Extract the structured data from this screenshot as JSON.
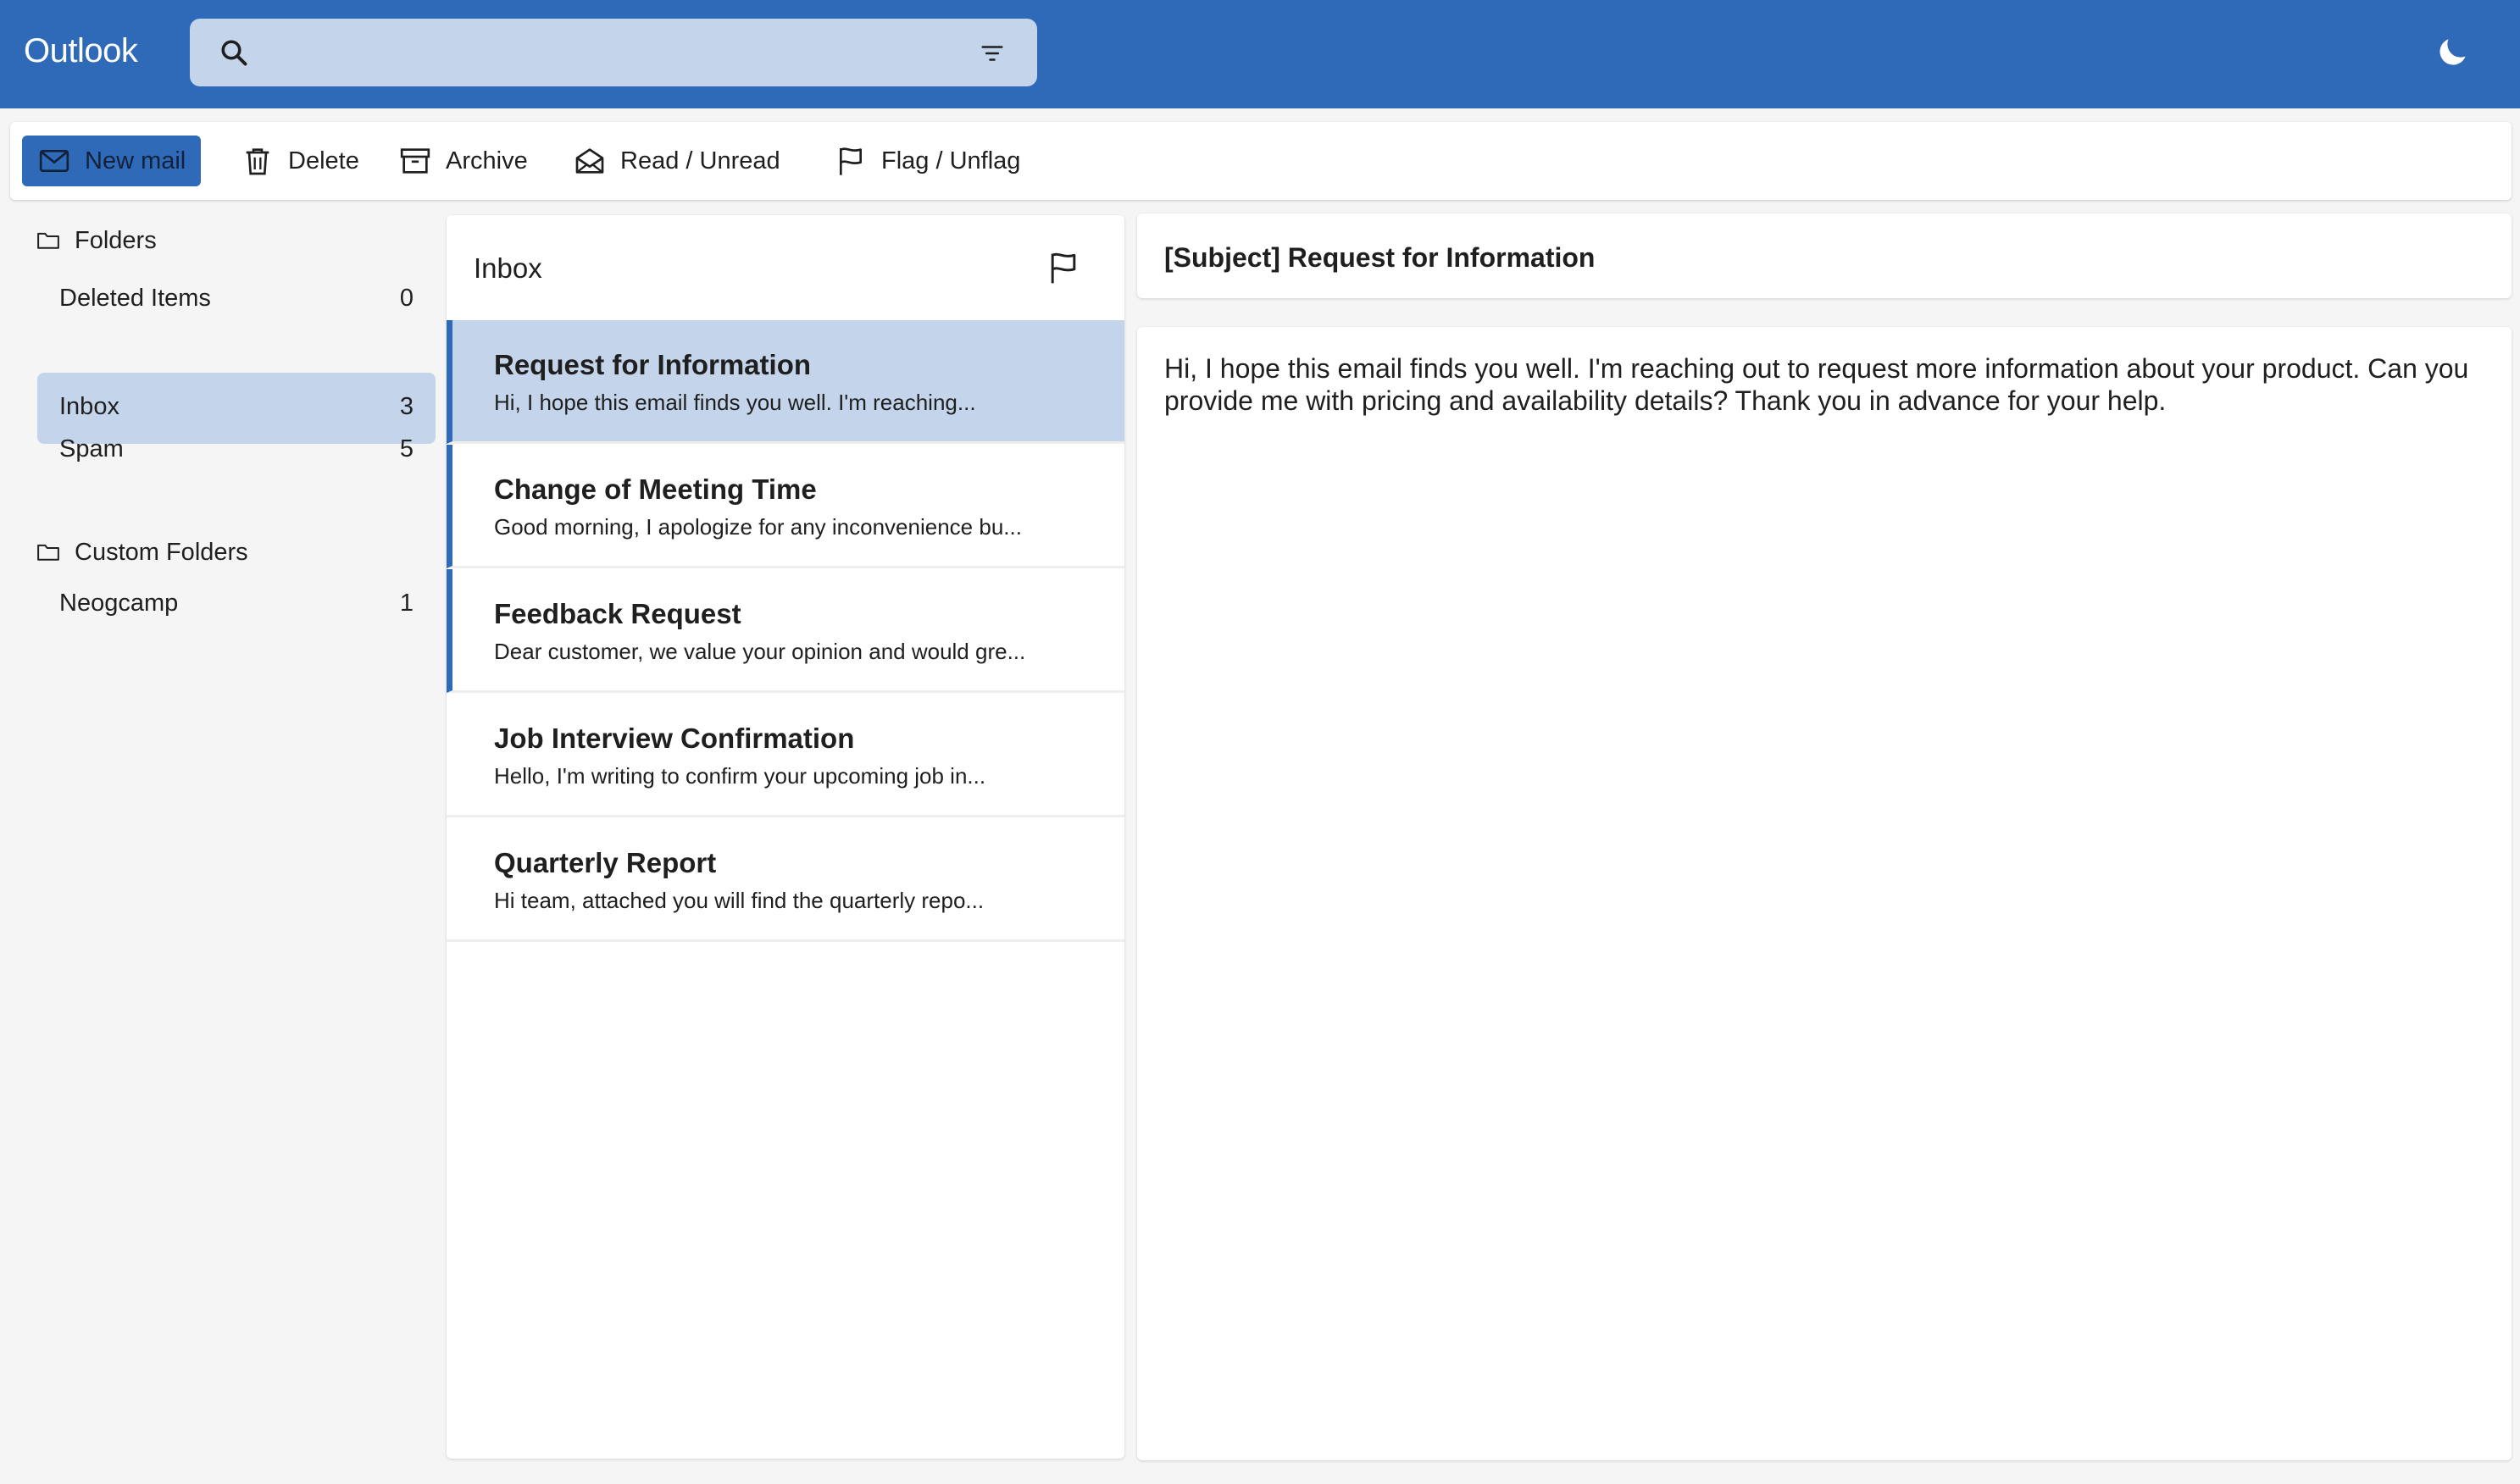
{
  "app": {
    "title": "Outlook"
  },
  "search": {
    "value": "",
    "placeholder": ""
  },
  "toolbar": {
    "new_mail": "New mail",
    "delete": "Delete",
    "archive": "Archive",
    "read_unread": "Read / Unread",
    "flag_unflag": "Flag / Unflag"
  },
  "sidebar": {
    "folders_header": "Folders",
    "folders": [
      {
        "name": "Deleted Items",
        "count": "0"
      },
      {
        "name": "Inbox",
        "count": "3",
        "active": true
      },
      {
        "name": "Spam",
        "count": "5"
      }
    ],
    "custom_header": "Custom Folders",
    "custom_folders": [
      {
        "name": "Neogcamp",
        "count": "1"
      }
    ]
  },
  "mail_list": {
    "title": "Inbox",
    "items": [
      {
        "subject": "Request for Information",
        "preview": "Hi, I hope this email finds you well. I'm reaching...",
        "unread": true,
        "selected": true
      },
      {
        "subject": "Change of Meeting Time",
        "preview": "Good morning, I apologize for any inconvenience bu...",
        "unread": true,
        "selected": false
      },
      {
        "subject": "Feedback Request",
        "preview": "Dear customer, we value your opinion and would gre...",
        "unread": true,
        "selected": false
      },
      {
        "subject": "Job Interview Confirmation",
        "preview": "Hello, I'm writing to confirm your upcoming job in...",
        "unread": false,
        "selected": false
      },
      {
        "subject": "Quarterly Report",
        "preview": "Hi team, attached you will find the quarterly repo...",
        "unread": false,
        "selected": false
      }
    ]
  },
  "reading_pane": {
    "subject": "[Subject] Request for Information",
    "body": "Hi, I hope this email finds you well. I'm reaching out to request more information about your product. Can you provide me with pricing and availability details? Thank you in advance for your help."
  },
  "colors": {
    "brand": "#2f6ab9",
    "selected": "#c3d4eb",
    "background": "#f5f5f5"
  },
  "icons": [
    "search-icon",
    "filter-icon",
    "moon-icon",
    "mail-icon",
    "trash-icon",
    "archive-icon",
    "envelope-open-icon",
    "flag-icon",
    "folder-icon"
  ]
}
